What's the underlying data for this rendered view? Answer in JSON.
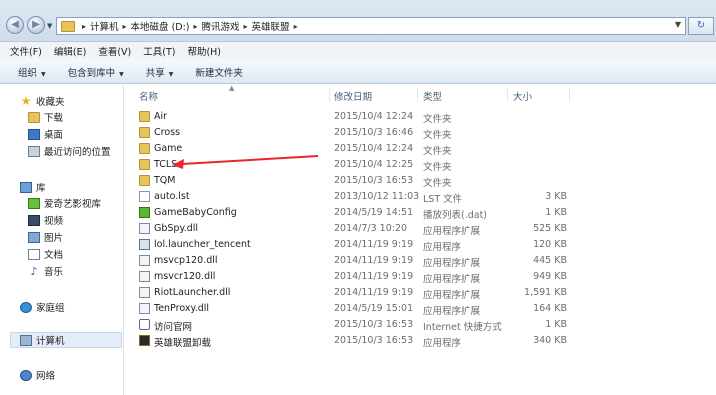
{
  "address_bar": {
    "breadcrumbs": [
      "计算机",
      "本地磁盘 (D:)",
      "腾讯游戏",
      "英雄联盟"
    ]
  },
  "menu": [
    "文件(F)",
    "编辑(E)",
    "查看(V)",
    "工具(T)",
    "帮助(H)"
  ],
  "toolbar": {
    "organize": "组织",
    "include_library": "包含到库中",
    "share": "共享",
    "new_folder": "新建文件夹"
  },
  "nav": {
    "favorites": "收藏夹",
    "downloads": "下载",
    "desktop": "桌面",
    "recent": "最近访问的位置",
    "libraries": "库",
    "iqiyi": "爱奇艺影视库",
    "videos": "视频",
    "pictures": "图片",
    "documents": "文档",
    "music": "音乐",
    "homegroup": "家庭组",
    "computer": "计算机",
    "network": "网络"
  },
  "columns": {
    "name": "名称",
    "date": "修改日期",
    "type": "类型",
    "size": "大小"
  },
  "files": [
    {
      "name": "Air",
      "date": "2015/10/4 12:24",
      "type": "文件夹",
      "size": "",
      "icon": "folder-icon"
    },
    {
      "name": "Cross",
      "date": "2015/10/3 16:46",
      "type": "文件夹",
      "size": "",
      "icon": "folder-icon"
    },
    {
      "name": "Game",
      "date": "2015/10/4 12:24",
      "type": "文件夹",
      "size": "",
      "icon": "folder-icon"
    },
    {
      "name": "TCLS",
      "date": "2015/10/4 12:25",
      "type": "文件夹",
      "size": "",
      "icon": "folder-icon"
    },
    {
      "name": "TQM",
      "date": "2015/10/3 16:53",
      "type": "文件夹",
      "size": "",
      "icon": "folder-icon"
    },
    {
      "name": "auto.lst",
      "date": "2013/10/12 11:03",
      "type": "LST 文件",
      "size": "3 KB",
      "icon": "file-icon"
    },
    {
      "name": "GameBabyConfig",
      "date": "2014/5/19 14:51",
      "type": "播放列表(.dat)",
      "size": "1 KB",
      "icon": "playlist-icon"
    },
    {
      "name": "GbSpy.dll",
      "date": "2014/7/3 10:20",
      "type": "应用程序扩展",
      "size": "525 KB",
      "icon": "dll-icon"
    },
    {
      "name": "lol.launcher_tencent",
      "date": "2014/11/19 9:19",
      "type": "应用程序",
      "size": "120 KB",
      "icon": "app-icon"
    },
    {
      "name": "msvcp120.dll",
      "date": "2014/11/19 9:19",
      "type": "应用程序扩展",
      "size": "445 KB",
      "icon": "dll-icon"
    },
    {
      "name": "msvcr120.dll",
      "date": "2014/11/19 9:19",
      "type": "应用程序扩展",
      "size": "949 KB",
      "icon": "dll-icon"
    },
    {
      "name": "RiotLauncher.dll",
      "date": "2014/11/19 9:19",
      "type": "应用程序扩展",
      "size": "1,591 KB",
      "icon": "dll-icon"
    },
    {
      "name": "TenProxy.dll",
      "date": "2014/5/19 15:01",
      "type": "应用程序扩展",
      "size": "164 KB",
      "icon": "dll-icon"
    },
    {
      "name": "访问官网",
      "date": "2015/10/3 16:53",
      "type": "Internet 快捷方式",
      "size": "1 KB",
      "icon": "internet-shortcut-icon"
    },
    {
      "name": "英雄联盟卸载",
      "date": "2015/10/3 16:53",
      "type": "应用程序",
      "size": "340 KB",
      "icon": "lol-uninstall-icon"
    }
  ],
  "annotation_color": "#e8262c"
}
